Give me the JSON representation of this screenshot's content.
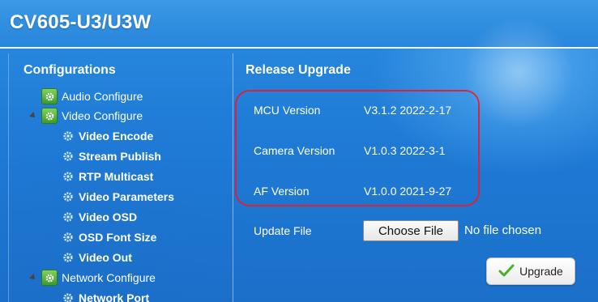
{
  "header": {
    "title": "CV605-U3/U3W"
  },
  "sidebar": {
    "heading": "Configurations",
    "items": [
      {
        "label": "Audio Configure",
        "level": 0,
        "icon": "gear-folder-icon"
      },
      {
        "label": "Video Configure",
        "level": 0,
        "icon": "gear-folder-icon",
        "expanded": true
      },
      {
        "label": "Video Encode",
        "level": 1,
        "icon": "gear-icon"
      },
      {
        "label": "Stream Publish",
        "level": 1,
        "icon": "gear-icon"
      },
      {
        "label": "RTP Multicast",
        "level": 1,
        "icon": "gear-icon"
      },
      {
        "label": "Video Parameters",
        "level": 1,
        "icon": "gear-icon"
      },
      {
        "label": "Video OSD",
        "level": 1,
        "icon": "gear-icon"
      },
      {
        "label": "OSD Font Size",
        "level": 1,
        "icon": "gear-icon"
      },
      {
        "label": "Video Out",
        "level": 1,
        "icon": "gear-icon"
      },
      {
        "label": "Network Configure",
        "level": 0,
        "icon": "gear-folder-icon",
        "expanded": true
      },
      {
        "label": "Network Port",
        "level": 1,
        "icon": "gear-icon"
      }
    ]
  },
  "main": {
    "heading": "Release Upgrade",
    "versions": [
      {
        "label": "MCU Version",
        "value": "V3.1.2 2022-2-17"
      },
      {
        "label": "Camera Version",
        "value": "V1.0.3 2022-3-1"
      },
      {
        "label": "AF Version",
        "value": "V1.0.0 2021-9-27"
      }
    ],
    "update_file": {
      "label": "Update File",
      "choose_button": "Choose File",
      "status": "No file chosen"
    },
    "upgrade_button": "Upgrade"
  },
  "colors": {
    "background": "#1f7bd6",
    "highlight_border": "#d8233a",
    "text": "#ffffff"
  }
}
